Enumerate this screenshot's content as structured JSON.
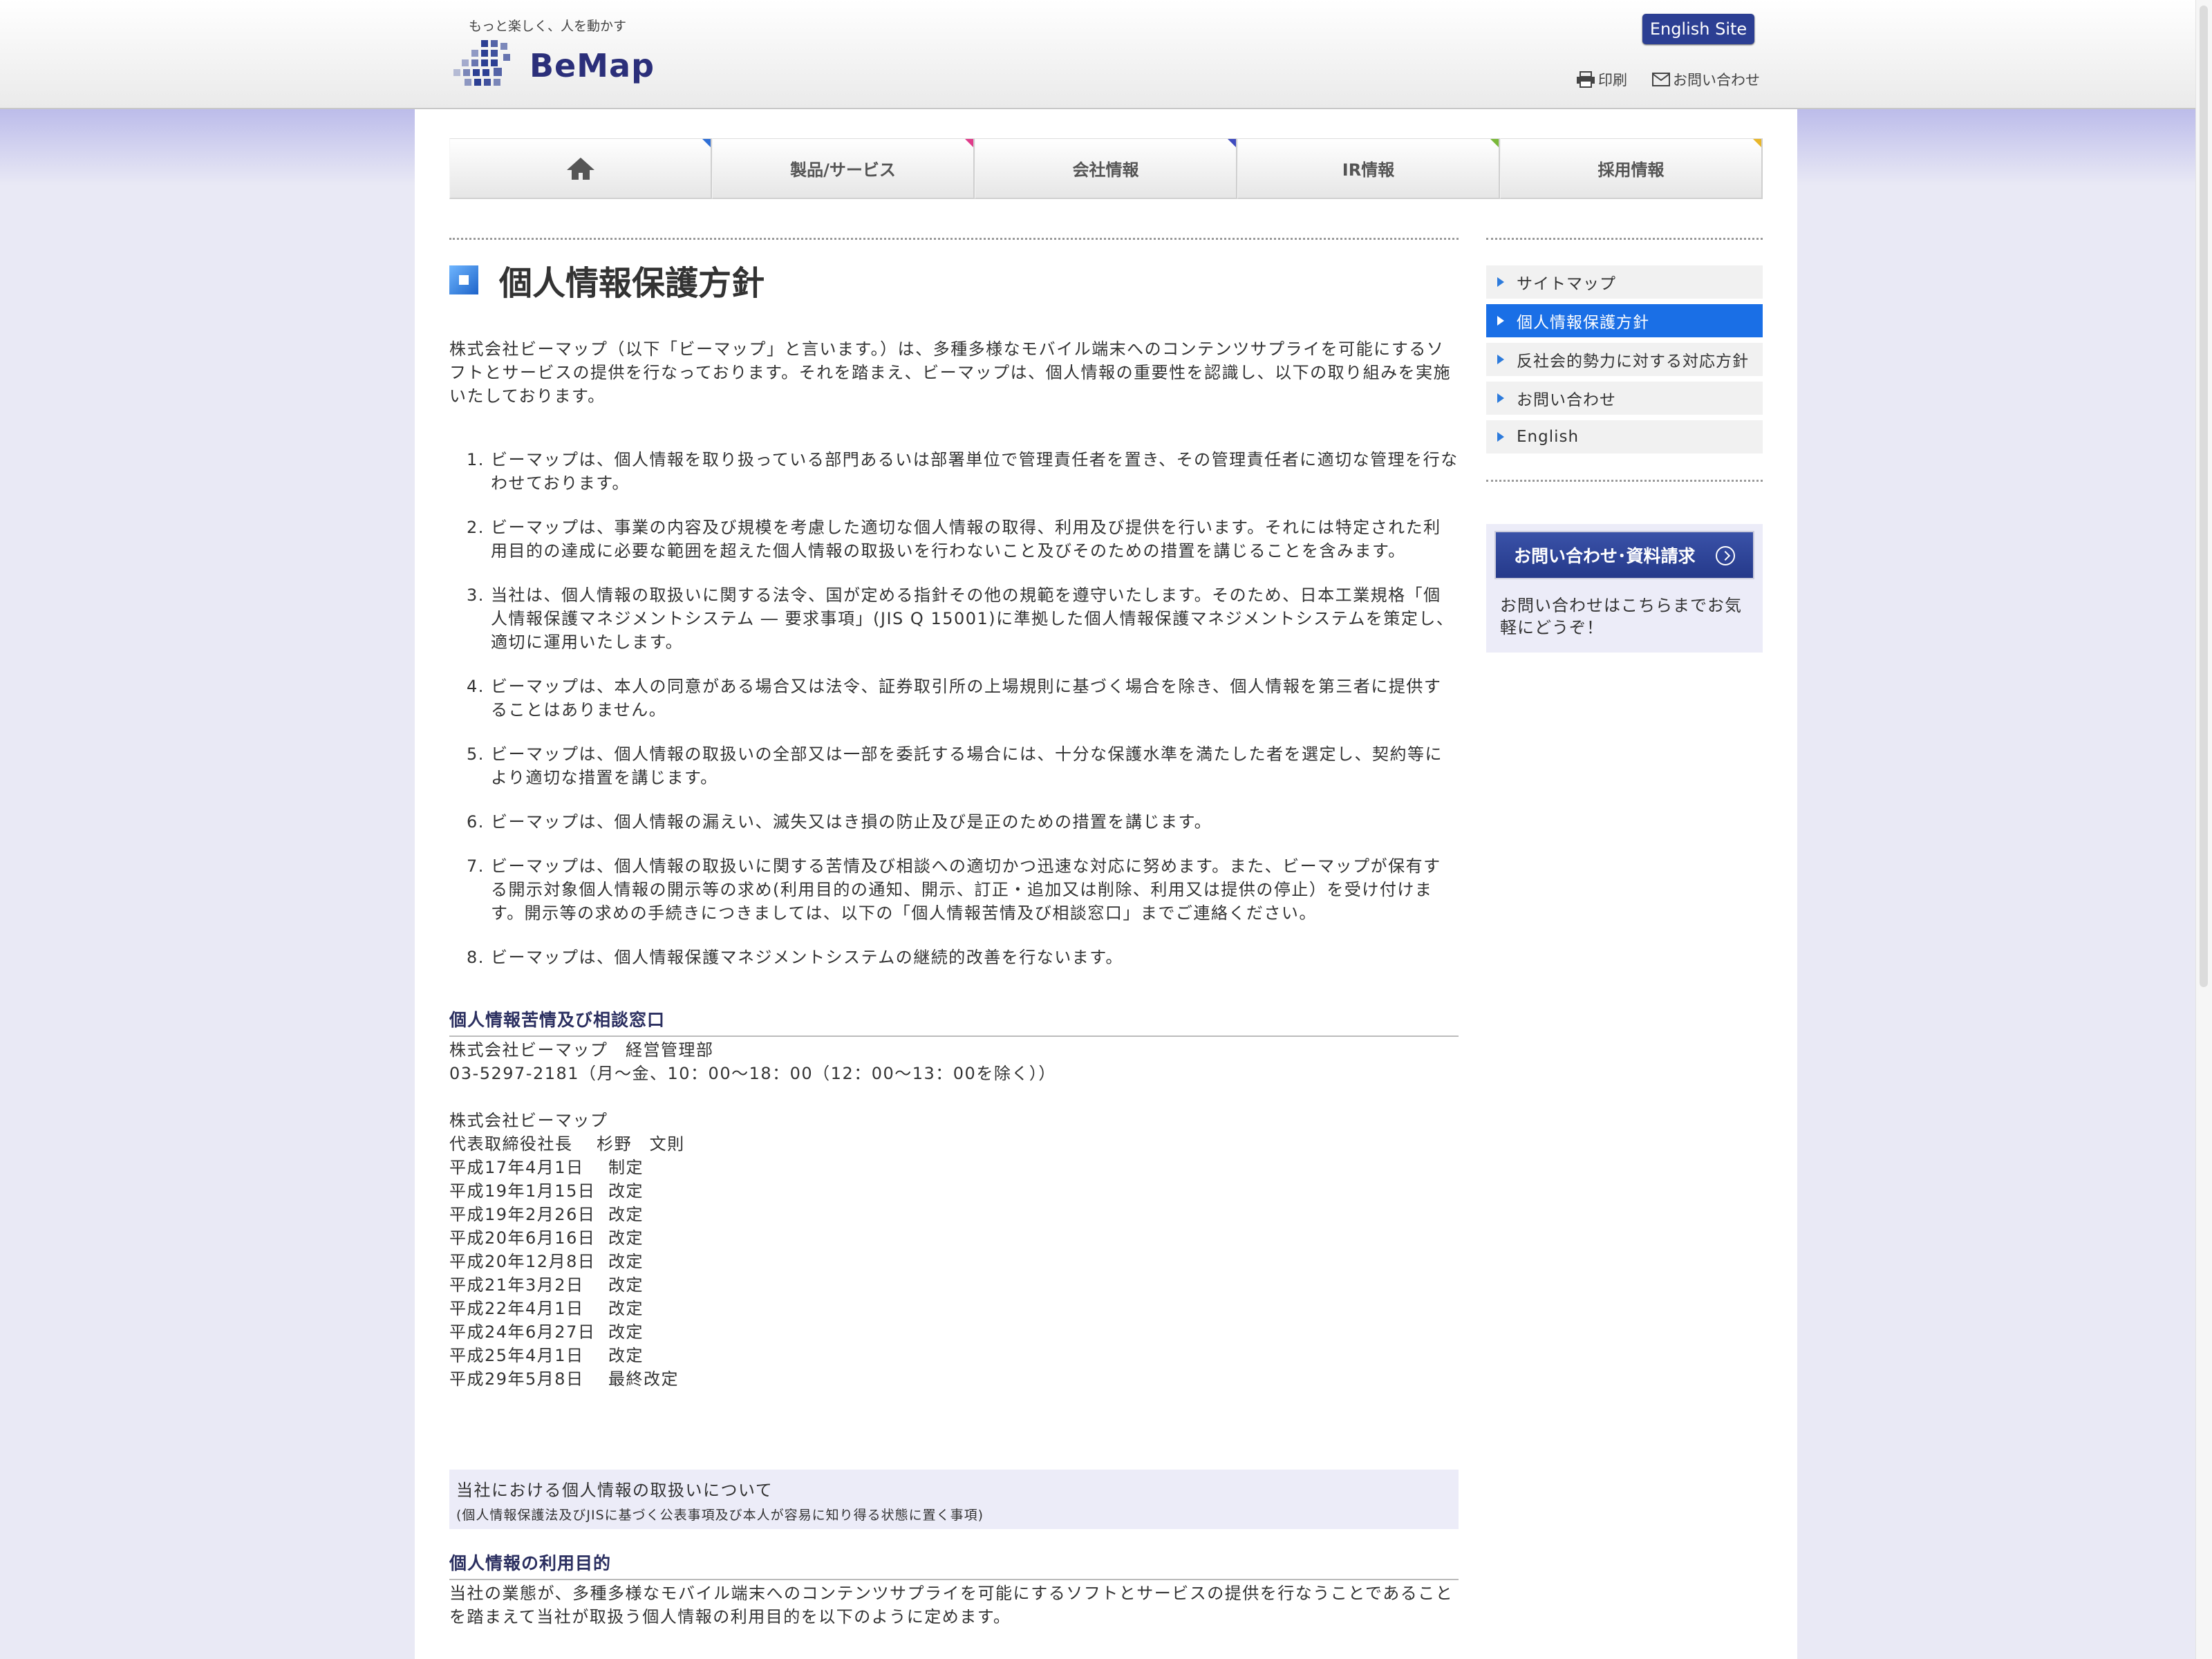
{
  "header": {
    "tagline": "もっと楽しく、人を動かす",
    "logo_text": "BeMap",
    "english_site": "English Site",
    "print": "印刷",
    "contact": "お問い合わせ"
  },
  "nav": {
    "home_icon": "home-icon",
    "tabs": [
      {
        "label": "製品/サービス",
        "accent": "#e03c8a"
      },
      {
        "label": "会社情報",
        "accent": "#3f4bbf"
      },
      {
        "label": "IR情報",
        "accent": "#7ab83a"
      },
      {
        "label": "採用情報",
        "accent": "#e8b62a"
      }
    ],
    "home_accent": "#2f6fd6"
  },
  "main": {
    "title": "個人情報保護方針",
    "intro": "株式会社ビーマップ（以下「ビーマップ」と言います。）は、多種多様なモバイル端末へのコンテンツサプライを可能にするソフトとサービスの提供を行なっております。それを踏まえ、ビーマップは、個人情報の重要性を認識し、以下の取り組みを実施いたしております。",
    "policy": [
      "ビーマップは、個人情報を取り扱っている部門あるいは部署単位で管理責任者を置き、その管理責任者に適切な管理を行なわせております。",
      "ビーマップは、事業の内容及び規模を考慮した適切な個人情報の取得、利用及び提供を行います。それには特定された利用目的の達成に必要な範囲を超えた個人情報の取扱いを行わないこと及びそのための措置を講じることを含みます。",
      "当社は、個人情報の取扱いに関する法令、国が定める指針その他の規範を遵守いたします。そのため、日本工業規格「個人情報保護マネジメントシステム ― 要求事項」(JIS Q 15001)に準拠した個人情報保護マネジメントシステムを策定し、適切に運用いたします。",
      "ビーマップは、本人の同意がある場合又は法令、証券取引所の上場規則に基づく場合を除き、個人情報を第三者に提供することはありません。",
      "ビーマップは、個人情報の取扱いの全部又は一部を委託する場合には、十分な保護水準を満たした者を選定し、契約等により適切な措置を講じます。",
      "ビーマップは、個人情報の漏えい、滅失又はき損の防止及び是正のための措置を講じます。",
      "ビーマップは、個人情報の取扱いに関する苦情及び相談への適切かつ迅速な対応に努めます。また、ビーマップが保有する開示対象個人情報の開示等の求め(利用目的の通知、開示、訂正・追加又は削除、利用又は提供の停止）を受け付けます。開示等の求めの手続きにつきましては、以下の「個人情報苦情及び相談窓口」までご連絡ください。",
      "ビーマップは、個人情報保護マネジメントシステムの継続的改善を行ないます。"
    ],
    "complaint_heading": "個人情報苦情及び相談窓口",
    "complaint_company": "株式会社ビーマップ　経営管理部",
    "complaint_phone": "03-5297-2181（月～金、10：00～18：00（12：00～13：00を除く））",
    "signature_company": "株式会社ビーマップ",
    "signature_person": "代表取締役社長　 杉野　文則",
    "history": [
      {
        "date": "平成17年4月1日",
        "action": "制定"
      },
      {
        "date": "平成19年1月15日",
        "action": "改定"
      },
      {
        "date": "平成19年2月26日",
        "action": "改定"
      },
      {
        "date": "平成20年6月16日",
        "action": "改定"
      },
      {
        "date": "平成20年12月8日",
        "action": "改定"
      },
      {
        "date": "平成21年3月2日",
        "action": "改定"
      },
      {
        "date": "平成22年4月1日",
        "action": "改定"
      },
      {
        "date": "平成24年6月27日",
        "action": "改定"
      },
      {
        "date": "平成25年4月1日",
        "action": "改定"
      },
      {
        "date": "平成29年5月8日",
        "action": "最終改定"
      }
    ],
    "notice_title": "当社における個人情報の取扱いについて",
    "notice_sub": "(個人情報保護法及びJISに基づく公表事項及び本人が容易に知り得る状態に置く事項)",
    "purpose_heading": "個人情報の利用目的",
    "purpose_text": "当社の業態が、多種多様なモバイル端末へのコンテンツサプライを可能にするソフトとサービスの提供を行なうことであることを踏まえて当社が取扱う個人情報の利用目的を以下のように定めます。"
  },
  "sidebar": {
    "items": [
      {
        "label": "サイトマップ",
        "active": false
      },
      {
        "label": "個人情報保護方針",
        "active": true
      },
      {
        "label": "反社会的勢力に対する対応方針",
        "active": false
      },
      {
        "label": "お問い合わせ",
        "active": false
      },
      {
        "label": "English",
        "active": false
      }
    ],
    "contact_button": "お問い合わせ･資料請求",
    "contact_note": "お問い合わせはこちらまでお気軽にどうぞ！"
  }
}
